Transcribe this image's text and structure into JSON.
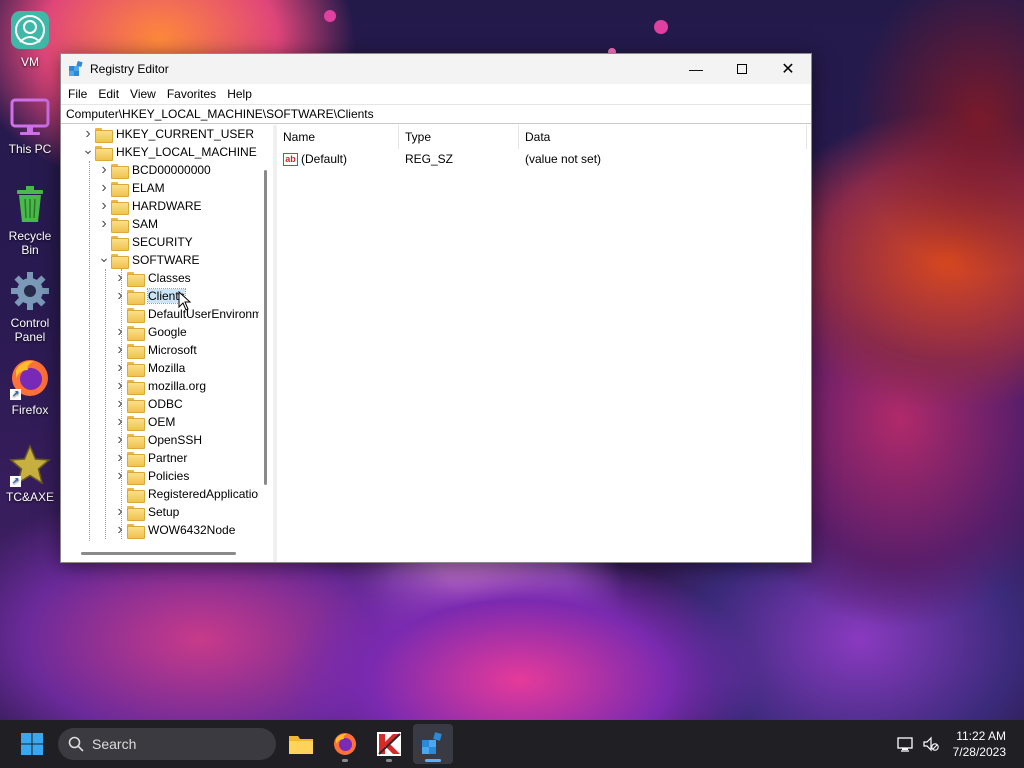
{
  "desktop": {
    "icons": [
      {
        "label": "VM",
        "icon": "vm-icon"
      },
      {
        "label": "This PC",
        "icon": "monitor-icon"
      },
      {
        "label": "Recycle Bin",
        "icon": "recycle-bin-icon"
      },
      {
        "label": "Control Panel",
        "icon": "gear-icon"
      },
      {
        "label": "Firefox",
        "icon": "firefox-icon"
      },
      {
        "label": "TC&AXE",
        "icon": "star-icon"
      }
    ]
  },
  "window": {
    "title": "Registry Editor",
    "menu": [
      "File",
      "Edit",
      "View",
      "Favorites",
      "Help"
    ],
    "address": "Computer\\HKEY_LOCAL_MACHINE\\SOFTWARE\\Clients",
    "tree": [
      {
        "label": "HKEY_CURRENT_USER",
        "level": 0,
        "expander": "collapsed"
      },
      {
        "label": "HKEY_LOCAL_MACHINE",
        "level": 0,
        "expander": "expanded"
      },
      {
        "label": "BCD00000000",
        "level": 1,
        "expander": "collapsed"
      },
      {
        "label": "ELAM",
        "level": 1,
        "expander": "collapsed"
      },
      {
        "label": "HARDWARE",
        "level": 1,
        "expander": "collapsed"
      },
      {
        "label": "SAM",
        "level": 1,
        "expander": "collapsed"
      },
      {
        "label": "SECURITY",
        "level": 1,
        "expander": "none"
      },
      {
        "label": "SOFTWARE",
        "level": 1,
        "expander": "expanded"
      },
      {
        "label": "Classes",
        "level": 2,
        "expander": "collapsed"
      },
      {
        "label": "Clients",
        "level": 2,
        "expander": "collapsed",
        "selected": true
      },
      {
        "label": "DefaultUserEnvironment",
        "level": 2,
        "expander": "none"
      },
      {
        "label": "Google",
        "level": 2,
        "expander": "collapsed"
      },
      {
        "label": "Microsoft",
        "level": 2,
        "expander": "collapsed"
      },
      {
        "label": "Mozilla",
        "level": 2,
        "expander": "collapsed"
      },
      {
        "label": "mozilla.org",
        "level": 2,
        "expander": "collapsed"
      },
      {
        "label": "ODBC",
        "level": 2,
        "expander": "collapsed"
      },
      {
        "label": "OEM",
        "level": 2,
        "expander": "collapsed"
      },
      {
        "label": "OpenSSH",
        "level": 2,
        "expander": "collapsed"
      },
      {
        "label": "Partner",
        "level": 2,
        "expander": "collapsed"
      },
      {
        "label": "Policies",
        "level": 2,
        "expander": "collapsed"
      },
      {
        "label": "RegisteredApplications",
        "level": 2,
        "expander": "none"
      },
      {
        "label": "Setup",
        "level": 2,
        "expander": "collapsed"
      },
      {
        "label": "WOW6432Node",
        "level": 2,
        "expander": "collapsed"
      }
    ],
    "list": {
      "columns": [
        "Name",
        "Type",
        "Data"
      ],
      "rows": [
        {
          "name": "(Default)",
          "type": "REG_SZ",
          "data": "(value not set)"
        }
      ]
    }
  },
  "taskbar": {
    "search_placeholder": "Search",
    "apps": [
      "start-icon",
      "file-explorer-icon",
      "firefox-icon",
      "kaspersky-icon",
      "registry-editor-icon"
    ],
    "time": "11:22 AM",
    "date": "7/28/2023"
  },
  "colors": {
    "selection": "#cce4f7",
    "taskbar": "#1f1f24",
    "folder": "#f0c24e"
  }
}
